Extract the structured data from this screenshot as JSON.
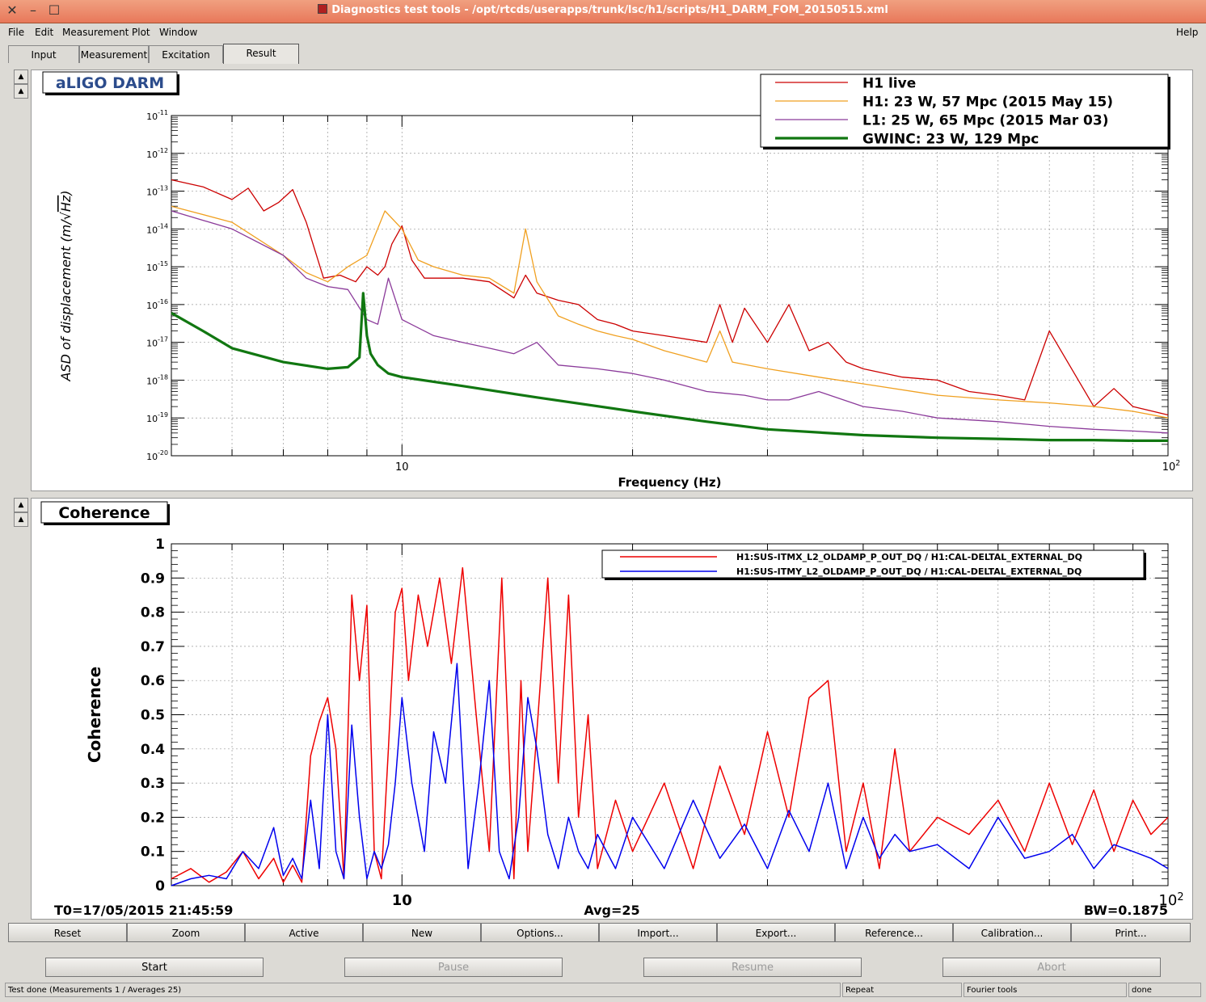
{
  "window": {
    "title": "Diagnostics test tools - /opt/rtcds/userapps/trunk/lsc/h1/scripts/H1_DARM_FOM_20150515.xml"
  },
  "menu": {
    "file": "File",
    "edit": "Edit",
    "measurement": "Measurement",
    "plot": "Plot",
    "window": "Window",
    "help": "Help"
  },
  "tabs": {
    "input": "Input",
    "measurement": "Measurement",
    "excitation": "Excitation",
    "result": "Result"
  },
  "chart_data": [
    {
      "type": "line",
      "title": "aLIGO DARM",
      "xlabel": "Frequency (Hz)",
      "ylabel_prefix": "ASD of displacement (m/",
      "ylabel_root": "Hz",
      "ylabel_suffix": ")",
      "xscale": "log",
      "yscale": "log",
      "xlim": [
        5,
        100
      ],
      "ylim": [
        1e-20,
        1e-11
      ],
      "grid": true,
      "legend_position": "top-right",
      "x_tick_labels": [
        {
          "value": 10,
          "label": "10"
        },
        {
          "value": 100,
          "base": "10",
          "exp": "2"
        }
      ],
      "y_tick_labels": [
        {
          "value": -11,
          "base": "10",
          "exp": "-11"
        },
        {
          "value": -12,
          "base": "10",
          "exp": "-12"
        },
        {
          "value": -13,
          "base": "10",
          "exp": "-13"
        },
        {
          "value": -14,
          "base": "10",
          "exp": "-14"
        },
        {
          "value": -15,
          "base": "10",
          "exp": "-15"
        },
        {
          "value": -16,
          "base": "10",
          "exp": "-16"
        },
        {
          "value": -17,
          "base": "10",
          "exp": "-17"
        },
        {
          "value": -18,
          "base": "10",
          "exp": "-18"
        },
        {
          "value": -19,
          "base": "10",
          "exp": "-19"
        },
        {
          "value": -20,
          "base": "10",
          "exp": "-20"
        }
      ],
      "series": [
        {
          "name": "H1 live",
          "color": "#cc0000",
          "width": 1.3,
          "x": [
            5,
            5.5,
            6,
            6.3,
            6.6,
            6.9,
            7.2,
            7.5,
            7.9,
            8.3,
            8.7,
            9.0,
            9.3,
            9.5,
            9.7,
            10.0,
            10.3,
            10.7,
            11.2,
            12,
            13,
            14,
            14.5,
            15,
            16,
            17,
            18,
            19,
            20,
            22,
            25,
            26,
            27,
            28,
            30,
            32,
            34,
            36,
            38,
            40,
            45,
            50,
            55,
            60,
            65,
            70,
            80,
            85,
            90,
            100
          ],
          "y": [
            2e-13,
            1.3e-13,
            6e-14,
            1.2e-13,
            3e-14,
            5e-14,
            1.1e-13,
            1.5e-14,
            5e-16,
            6e-16,
            4e-16,
            1e-15,
            6e-16,
            1e-15,
            4e-15,
            1.2e-14,
            1.5e-15,
            5e-16,
            5e-16,
            5e-16,
            4e-16,
            1.5e-16,
            6e-16,
            2e-16,
            1.3e-16,
            1e-16,
            4e-17,
            3e-17,
            2e-17,
            1.5e-17,
            1e-17,
            1e-16,
            1e-17,
            8e-17,
            1e-17,
            1e-16,
            6e-18,
            1e-17,
            3e-18,
            2e-18,
            1.2e-18,
            1e-18,
            5e-19,
            4e-19,
            3e-19,
            2e-17,
            2e-19,
            6e-19,
            2e-19,
            1.2e-19
          ]
        },
        {
          "name": "H1: 23 W, 57 Mpc (2015 May 15)",
          "color": "#f0a020",
          "width": 1.3,
          "x": [
            5,
            6,
            7,
            7.5,
            8,
            8.5,
            9,
            9.5,
            10,
            10.5,
            11,
            12,
            13,
            14,
            14.5,
            15,
            16,
            17,
            18,
            19,
            20,
            22,
            25,
            26,
            27,
            30,
            35,
            40,
            50,
            60,
            70,
            80,
            90,
            100
          ],
          "y": [
            4e-14,
            1.5e-14,
            2e-15,
            7e-16,
            4e-16,
            1e-15,
            2e-15,
            3e-14,
            1e-14,
            1.5e-15,
            1e-15,
            6e-16,
            5e-16,
            2e-16,
            1e-14,
            4e-16,
            5e-17,
            3e-17,
            2e-17,
            1.5e-17,
            1.2e-17,
            6e-18,
            3e-18,
            2e-17,
            3e-18,
            2e-18,
            1.2e-18,
            8e-19,
            4e-19,
            3e-19,
            2.5e-19,
            2e-19,
            1.5e-19,
            1e-19
          ]
        },
        {
          "name": "L1: 25 W, 65 Mpc (2015 Mar 03)",
          "color": "#8b3a9a",
          "width": 1.3,
          "x": [
            5,
            6,
            7,
            7.5,
            8,
            8.5,
            9,
            9.3,
            9.6,
            10,
            11,
            12,
            13,
            14,
            15,
            16,
            18,
            20,
            22,
            25,
            28,
            30,
            32,
            35,
            40,
            45,
            50,
            60,
            70,
            80,
            90,
            100
          ],
          "y": [
            3e-14,
            1e-14,
            2e-15,
            5e-16,
            3e-16,
            2.5e-16,
            4e-17,
            3e-17,
            5e-16,
            4e-17,
            1.5e-17,
            1e-17,
            7e-18,
            5e-18,
            1e-17,
            2.5e-18,
            2e-18,
            1.5e-18,
            1e-18,
            5e-19,
            4e-19,
            3e-19,
            3e-19,
            5e-19,
            2e-19,
            1.5e-19,
            1e-19,
            8e-20,
            6e-20,
            5e-20,
            4.5e-20,
            4e-20
          ]
        },
        {
          "name": "GWINC: 23 W, 129 Mpc",
          "color": "#117711",
          "width": 3.2,
          "x": [
            5,
            5.5,
            6,
            7,
            8,
            8.5,
            8.8,
            8.9,
            9.0,
            9.1,
            9.3,
            9.6,
            10,
            12,
            15,
            20,
            25,
            30,
            40,
            50,
            60,
            70,
            80,
            90,
            100
          ],
          "y": [
            6e-17,
            2e-17,
            7e-18,
            3e-18,
            2e-18,
            2.2e-18,
            4e-18,
            2e-16,
            1.5e-17,
            5e-18,
            2.5e-18,
            1.5e-18,
            1.2e-18,
            7e-19,
            3.5e-19,
            1.5e-19,
            8e-20,
            5e-20,
            3.5e-20,
            3e-20,
            2.8e-20,
            2.6e-20,
            2.6e-20,
            2.5e-20,
            2.5e-20
          ]
        }
      ]
    },
    {
      "type": "line",
      "title": "Coherence",
      "xlabel": "",
      "ylabel": "Coherence",
      "xscale": "log",
      "xlim": [
        5,
        100
      ],
      "ylim": [
        0,
        1
      ],
      "grid": true,
      "legend_position": "top-right",
      "x_tick_labels": [
        {
          "value": 10,
          "label": "10"
        },
        {
          "value": 100,
          "base": "10",
          "exp": "2"
        }
      ],
      "y_tick_labels": [
        "0",
        "0.1",
        "0.2",
        "0.3",
        "0.4",
        "0.5",
        "0.6",
        "0.7",
        "0.8",
        "0.9",
        "1"
      ],
      "footer": {
        "t0": "T0=17/05/2015 21:45:59",
        "avg": "Avg=25",
        "bw": "BW=0.1875"
      },
      "series": [
        {
          "name": "H1:SUS-ITMX_L2_OLDAMP_P_OUT_DQ / H1:CAL-DELTAL_EXTERNAL_DQ",
          "color": "#ee0000",
          "width": 1.5,
          "x": [
            5,
            5.3,
            5.6,
            5.9,
            6.2,
            6.5,
            6.8,
            7.0,
            7.2,
            7.4,
            7.6,
            7.8,
            8.0,
            8.2,
            8.4,
            8.6,
            8.8,
            9.0,
            9.2,
            9.4,
            9.6,
            9.8,
            10.0,
            10.2,
            10.5,
            10.8,
            11.2,
            11.6,
            12.0,
            12.5,
            13.0,
            13.5,
            14.0,
            14.3,
            14.6,
            15.0,
            15.5,
            16.0,
            16.5,
            17.0,
            17.5,
            18,
            19,
            20,
            22,
            24,
            26,
            28,
            30,
            32,
            34,
            36,
            38,
            40,
            42,
            44,
            46,
            50,
            55,
            60,
            65,
            70,
            75,
            80,
            85,
            90,
            95,
            100
          ],
          "y": [
            0.02,
            0.05,
            0.01,
            0.04,
            0.1,
            0.02,
            0.08,
            0.01,
            0.06,
            0.01,
            0.38,
            0.48,
            0.55,
            0.4,
            0.02,
            0.85,
            0.6,
            0.82,
            0.1,
            0.02,
            0.4,
            0.8,
            0.87,
            0.6,
            0.85,
            0.7,
            0.9,
            0.65,
            0.93,
            0.5,
            0.1,
            0.9,
            0.02,
            0.6,
            0.1,
            0.45,
            0.9,
            0.3,
            0.85,
            0.2,
            0.5,
            0.05,
            0.25,
            0.1,
            0.3,
            0.05,
            0.35,
            0.15,
            0.45,
            0.2,
            0.55,
            0.6,
            0.1,
            0.3,
            0.05,
            0.4,
            0.1,
            0.2,
            0.15,
            0.25,
            0.1,
            0.3,
            0.12,
            0.28,
            0.1,
            0.25,
            0.15,
            0.2
          ]
        },
        {
          "name": "H1:SUS-ITMY_L2_OLDAMP_P_OUT_DQ / H1:CAL-DELTAL_EXTERNAL_DQ",
          "color": "#0000ee",
          "width": 1.5,
          "x": [
            5,
            5.3,
            5.6,
            5.9,
            6.2,
            6.5,
            6.8,
            7.0,
            7.2,
            7.4,
            7.6,
            7.8,
            8.0,
            8.2,
            8.4,
            8.6,
            8.8,
            9.0,
            9.2,
            9.4,
            9.6,
            9.8,
            10.0,
            10.3,
            10.7,
            11.0,
            11.4,
            11.8,
            12.2,
            12.6,
            13.0,
            13.4,
            13.8,
            14.2,
            14.6,
            15.0,
            15.5,
            16.0,
            16.5,
            17.0,
            17.5,
            18,
            19,
            20,
            22,
            24,
            26,
            28,
            30,
            32,
            34,
            36,
            38,
            40,
            42,
            44,
            46,
            50,
            55,
            60,
            65,
            70,
            75,
            80,
            85,
            90,
            95,
            100
          ],
          "y": [
            0.0,
            0.02,
            0.03,
            0.02,
            0.1,
            0.05,
            0.17,
            0.03,
            0.08,
            0.02,
            0.25,
            0.05,
            0.5,
            0.1,
            0.02,
            0.47,
            0.2,
            0.02,
            0.1,
            0.05,
            0.12,
            0.3,
            0.55,
            0.3,
            0.1,
            0.45,
            0.3,
            0.65,
            0.05,
            0.3,
            0.6,
            0.1,
            0.02,
            0.2,
            0.55,
            0.4,
            0.15,
            0.05,
            0.2,
            0.1,
            0.05,
            0.15,
            0.05,
            0.2,
            0.05,
            0.25,
            0.08,
            0.18,
            0.05,
            0.22,
            0.1,
            0.3,
            0.05,
            0.2,
            0.08,
            0.15,
            0.1,
            0.12,
            0.05,
            0.2,
            0.08,
            0.1,
            0.15,
            0.05,
            0.12,
            0.1,
            0.08,
            0.05
          ]
        }
      ]
    }
  ],
  "buttons": {
    "reset": "Reset",
    "zoom": "Zoom",
    "active": "Active",
    "new": "New",
    "options": "Options...",
    "import": "Import...",
    "export": "Export...",
    "reference": "Reference...",
    "calibration": "Calibration...",
    "print": "Print..."
  },
  "control": {
    "start": "Start",
    "pause": "Pause",
    "resume": "Resume",
    "abort": "Abort"
  },
  "status": {
    "message": "Test done (Measurements 1 / Averages 25)",
    "mode": "Repeat",
    "tool": "Fourier tools",
    "state": "done"
  }
}
